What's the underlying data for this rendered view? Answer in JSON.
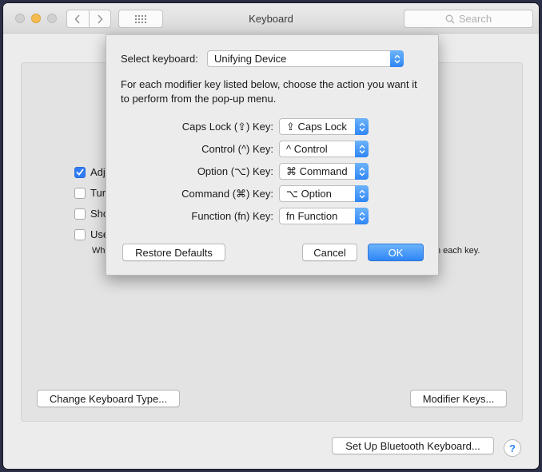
{
  "window": {
    "title": "Keyboard",
    "search_placeholder": "Search"
  },
  "background_pane": {
    "checkboxes": [
      {
        "label": "Adj",
        "checked": true
      },
      {
        "label": "Tur",
        "checked": false
      },
      {
        "label": "Sho",
        "checked": false
      },
      {
        "label": "Use",
        "checked": false
      }
    ],
    "sub_text_left": "Wh",
    "sub_text_right": "n each key.",
    "change_keyboard_type": "Change Keyboard Type...",
    "modifier_keys": "Modifier Keys...",
    "setup_bluetooth": "Set Up Bluetooth Keyboard...",
    "help": "?"
  },
  "sheet": {
    "select_keyboard_label": "Select keyboard:",
    "select_keyboard_value": "Unifying Device",
    "description": "For each modifier key listed below, choose the action you want it to perform from the pop-up menu.",
    "rows": [
      {
        "label": "Caps Lock (⇪) Key:",
        "value": "⇪ Caps Lock"
      },
      {
        "label": "Control (^) Key:",
        "value": "^ Control"
      },
      {
        "label": "Option (⌥) Key:",
        "value": "⌘ Command"
      },
      {
        "label": "Command (⌘) Key:",
        "value": "⌥ Option"
      },
      {
        "label": "Function (fn) Key:",
        "value": "fn Function"
      }
    ],
    "restore_defaults": "Restore Defaults",
    "cancel": "Cancel",
    "ok": "OK"
  },
  "colors": {
    "accent": "#2f86f6",
    "traffic_minimize": "#f5bd4f"
  }
}
